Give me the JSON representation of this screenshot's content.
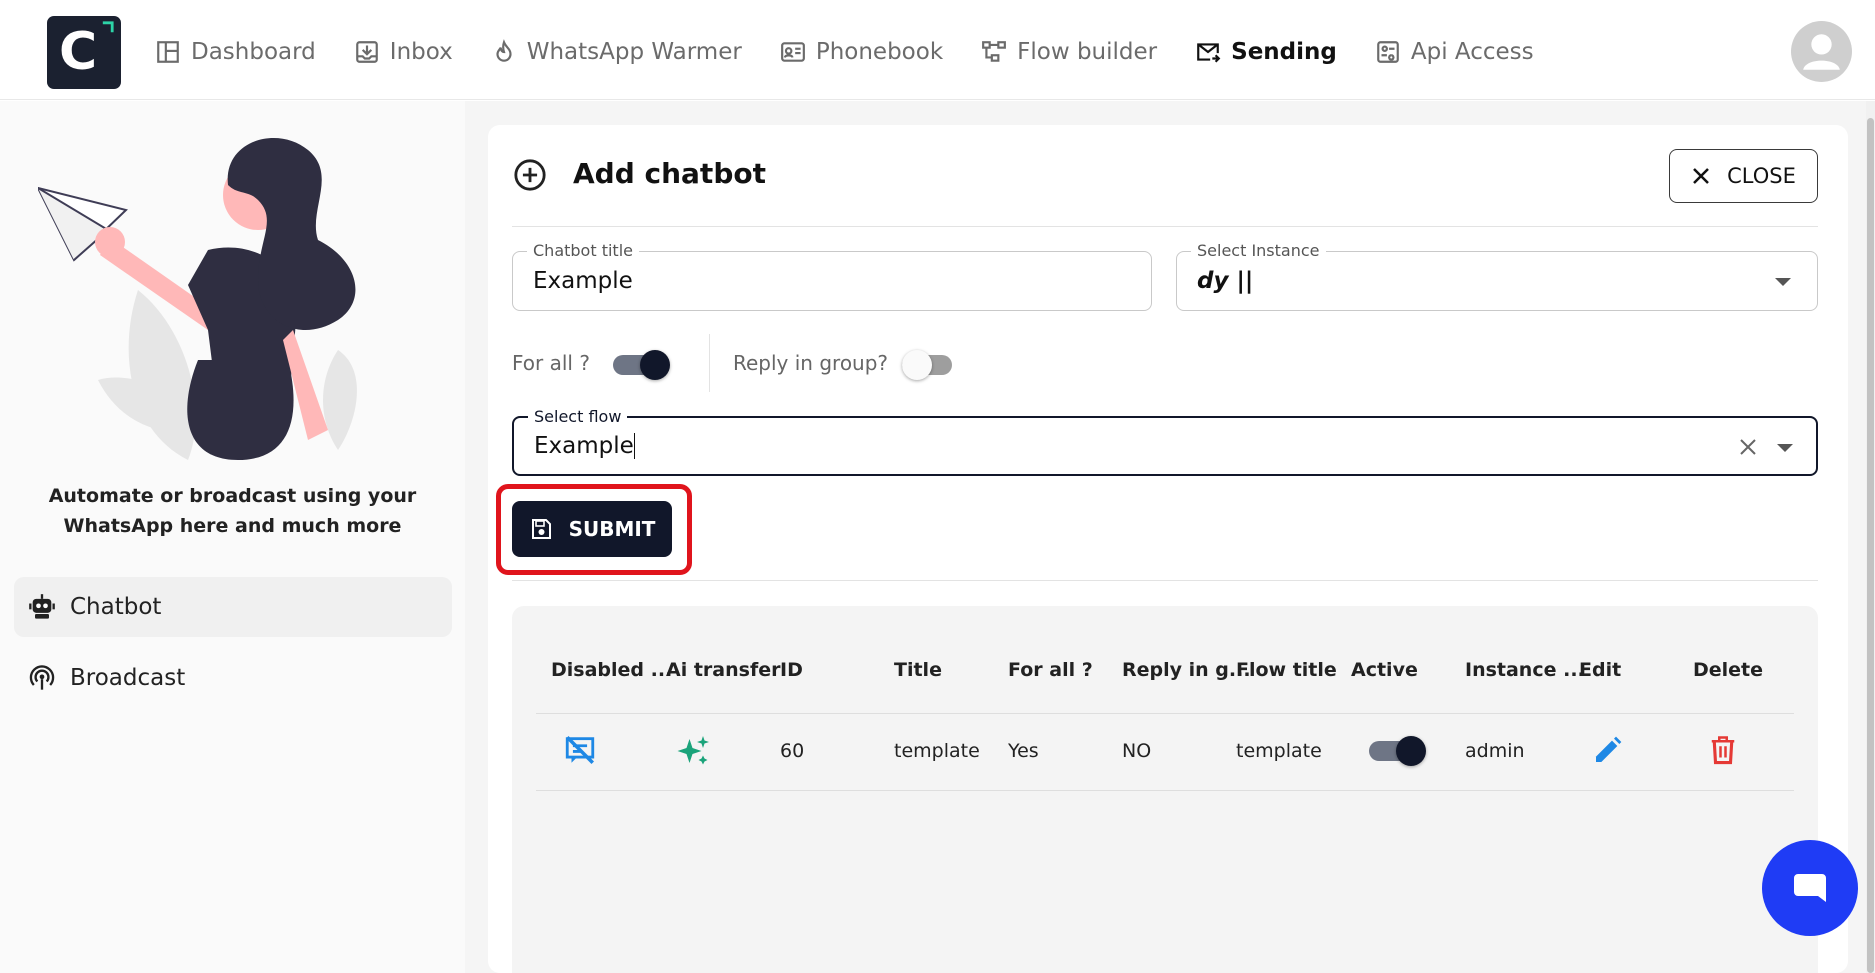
{
  "app": {
    "logo_letter": "C"
  },
  "nav": {
    "items": [
      {
        "label": "Dashboard",
        "icon": "dashboard-icon",
        "active": false
      },
      {
        "label": "Inbox",
        "icon": "inbox-icon",
        "active": false
      },
      {
        "label": "WhatsApp Warmer",
        "icon": "flame-icon",
        "active": false
      },
      {
        "label": "Phonebook",
        "icon": "contact-card-icon",
        "active": false
      },
      {
        "label": "Flow builder",
        "icon": "flow-icon",
        "active": false
      },
      {
        "label": "Sending",
        "icon": "mail-send-icon",
        "active": true
      },
      {
        "label": "Api Access",
        "icon": "api-icon",
        "active": false
      }
    ]
  },
  "sidebar": {
    "promo_line1": "Automate or broadcast using your",
    "promo_line2": "WhatsApp here and much more",
    "items": [
      {
        "label": "Chatbot",
        "icon": "robot-icon",
        "active": true
      },
      {
        "label": "Broadcast",
        "icon": "broadcast-icon",
        "active": false
      }
    ]
  },
  "form": {
    "title": "Add chatbot",
    "close_label": "CLOSE",
    "chatbot_title_label": "Chatbot title",
    "chatbot_title_value": "Example",
    "instance_label": "Select Instance",
    "instance_value": "dy ||",
    "for_all_label": "For all ?",
    "for_all_on": true,
    "reply_group_label": "Reply in group?",
    "reply_group_on": false,
    "flow_label": "Select flow",
    "flow_value": "Example",
    "submit_label": "SUBMIT"
  },
  "table": {
    "headers": [
      "Disabled ...",
      "Ai transfer",
      "ID",
      "Title",
      "For all ?",
      "Reply in g...",
      "Flow title",
      "Active",
      "Instance ...",
      "Edit",
      "Delete"
    ],
    "rows": [
      {
        "id": "60",
        "title": "template",
        "for_all": "Yes",
        "reply_group": "NO",
        "flow_title": "template",
        "active": true,
        "instance": "admin"
      }
    ]
  },
  "colors": {
    "primary_dark": "#11172a",
    "accent_blue": "#1f3cf5",
    "highlight_red": "#e0141c",
    "ai_green": "#1aa37a",
    "edit_blue": "#1e88e5",
    "delete_red": "#e53935"
  }
}
